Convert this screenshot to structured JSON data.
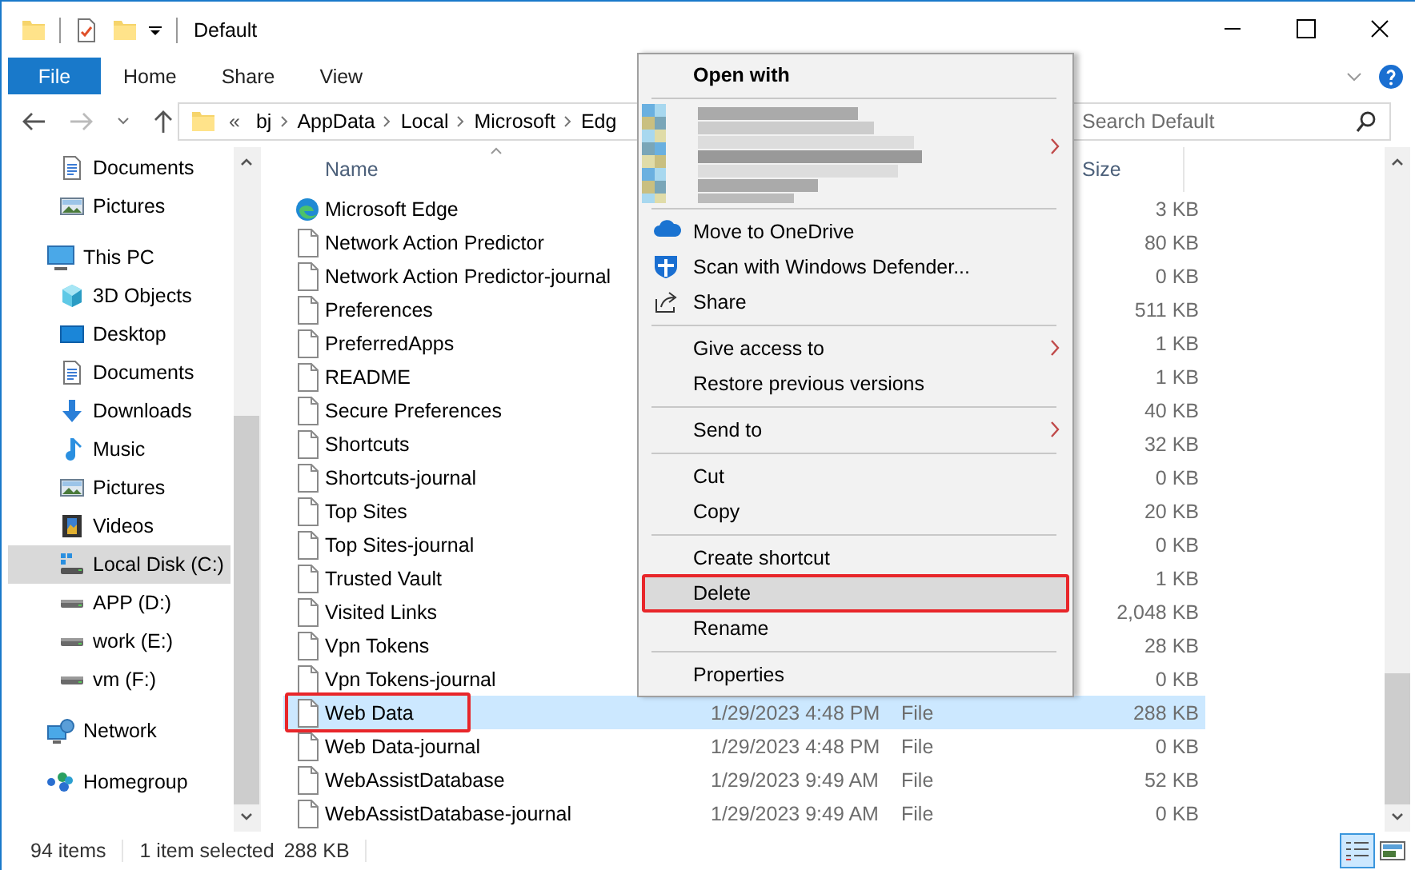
{
  "window": {
    "title": "Default"
  },
  "ribbon": {
    "file_tab": "File",
    "tabs": [
      "Home",
      "Share",
      "View"
    ]
  },
  "address_bar": {
    "overflow": "«",
    "path": [
      "bj",
      "AppData",
      "Local",
      "Microsoft",
      "Edg"
    ]
  },
  "search": {
    "placeholder": "Search Default"
  },
  "sidebar": {
    "pinned_items": [
      {
        "label": "Documents",
        "kind": "documents",
        "selected": false
      },
      {
        "label": "Pictures",
        "kind": "pictures",
        "selected": false
      }
    ],
    "items": [
      {
        "label": "This PC",
        "kind": "pc",
        "selected": false,
        "children": [
          {
            "label": "3D Objects",
            "kind": "objects",
            "selected": false
          },
          {
            "label": "Desktop",
            "kind": "desktop",
            "selected": false
          },
          {
            "label": "Documents",
            "kind": "documents",
            "selected": false
          },
          {
            "label": "Downloads",
            "kind": "downloads",
            "selected": false
          },
          {
            "label": "Music",
            "kind": "music",
            "selected": false
          },
          {
            "label": "Pictures",
            "kind": "pictures",
            "selected": false
          },
          {
            "label": "Videos",
            "kind": "videos",
            "selected": false
          },
          {
            "label": "Local Disk (C:)",
            "kind": "system_disk",
            "selected": true
          },
          {
            "label": "APP (D:)",
            "kind": "disk",
            "selected": false
          },
          {
            "label": "work (E:)",
            "kind": "disk",
            "selected": false
          },
          {
            "label": "vm (F:)",
            "kind": "disk",
            "selected": false
          }
        ]
      },
      {
        "label": "Network",
        "kind": "network",
        "selected": false
      },
      {
        "label": "Homegroup",
        "kind": "homegroup",
        "selected": false
      }
    ]
  },
  "file_list": {
    "columns": [
      "Name",
      "Size"
    ],
    "rows": [
      {
        "name": "Microsoft Edge",
        "kind": "edge",
        "size": "3 KB",
        "selected": false,
        "annotated": false
      },
      {
        "name": "Network Action Predictor",
        "kind": "file",
        "size": "80 KB",
        "selected": false,
        "annotated": false
      },
      {
        "name": "Network Action Predictor-journal",
        "kind": "file",
        "size": "0 KB",
        "selected": false,
        "annotated": false
      },
      {
        "name": "Preferences",
        "kind": "file",
        "size": "511 KB",
        "selected": false,
        "annotated": false
      },
      {
        "name": "PreferredApps",
        "kind": "file",
        "size": "1 KB",
        "selected": false,
        "annotated": false
      },
      {
        "name": "README",
        "kind": "file",
        "size": "1 KB",
        "selected": false,
        "annotated": false
      },
      {
        "name": "Secure Preferences",
        "kind": "file",
        "size": "40 KB",
        "selected": false,
        "annotated": false
      },
      {
        "name": "Shortcuts",
        "kind": "file",
        "size": "32 KB",
        "selected": false,
        "annotated": false
      },
      {
        "name": "Shortcuts-journal",
        "kind": "file",
        "size": "0 KB",
        "selected": false,
        "annotated": false
      },
      {
        "name": "Top Sites",
        "kind": "file",
        "size": "20 KB",
        "selected": false,
        "annotated": false
      },
      {
        "name": "Top Sites-journal",
        "kind": "file",
        "size": "0 KB",
        "selected": false,
        "annotated": false
      },
      {
        "name": "Trusted Vault",
        "kind": "file",
        "size": "1 KB",
        "selected": false,
        "annotated": false
      },
      {
        "name": "Visited Links",
        "kind": "file",
        "size": "2,048 KB",
        "selected": false,
        "annotated": false
      },
      {
        "name": "Vpn Tokens",
        "kind": "file",
        "size": "28 KB",
        "selected": false,
        "annotated": false
      },
      {
        "name": "Vpn Tokens-journal",
        "kind": "file",
        "size": "0 KB",
        "selected": false,
        "annotated": false
      },
      {
        "name": "Web Data",
        "kind": "file",
        "date": "1/29/2023 4:48 PM",
        "type": "File",
        "size": "288 KB",
        "selected": true,
        "annotated": true
      },
      {
        "name": "Web Data-journal",
        "kind": "file",
        "date": "1/29/2023 4:48 PM",
        "type": "File",
        "size": "0 KB",
        "selected": false,
        "annotated": false
      },
      {
        "name": "WebAssistDatabase",
        "kind": "file",
        "date": "1/29/2023 9:49 AM",
        "type": "File",
        "size": "52 KB",
        "selected": false,
        "annotated": false
      },
      {
        "name": "WebAssistDatabase-journal",
        "kind": "file",
        "date": "1/29/2023 9:49 AM",
        "type": "File",
        "size": "0 KB",
        "selected": false,
        "annotated": false
      }
    ]
  },
  "context_menu": {
    "groups": [
      [
        {
          "label": "Open with",
          "kind": "header",
          "submenu": false,
          "hovered": false,
          "annotated": false
        }
      ],
      [
        {
          "kind": "redacted",
          "submenu": true,
          "hovered": false,
          "annotated": false
        }
      ],
      [
        {
          "label": "Move to OneDrive",
          "kind": "onedrive",
          "submenu": false,
          "hovered": false,
          "annotated": false
        },
        {
          "label": "Scan with Windows Defender...",
          "kind": "shield",
          "submenu": false,
          "hovered": false,
          "annotated": false
        },
        {
          "label": "Share",
          "kind": "share",
          "submenu": false,
          "hovered": false,
          "annotated": false
        }
      ],
      [
        {
          "label": "Give access to",
          "kind": "plain",
          "submenu": true,
          "hovered": false,
          "annotated": false
        },
        {
          "label": "Restore previous versions",
          "kind": "plain",
          "submenu": false,
          "hovered": false,
          "annotated": false
        }
      ],
      [
        {
          "label": "Send to",
          "kind": "plain",
          "submenu": true,
          "hovered": false,
          "annotated": false
        }
      ],
      [
        {
          "label": "Cut",
          "kind": "plain",
          "submenu": false,
          "hovered": false,
          "annotated": false
        },
        {
          "label": "Copy",
          "kind": "plain",
          "submenu": false,
          "hovered": false,
          "annotated": false
        }
      ],
      [
        {
          "label": "Create shortcut",
          "kind": "plain",
          "submenu": false,
          "hovered": false,
          "annotated": false
        },
        {
          "label": "Delete",
          "kind": "plain",
          "submenu": false,
          "hovered": true,
          "annotated": true
        },
        {
          "label": "Rename",
          "kind": "plain",
          "submenu": false,
          "hovered": false,
          "annotated": false
        }
      ],
      [
        {
          "label": "Properties",
          "kind": "plain",
          "submenu": false,
          "hovered": false,
          "annotated": false
        }
      ]
    ]
  },
  "status_bar": {
    "item_count": "94 items",
    "selection": "1 item selected",
    "size": "288 KB"
  },
  "view_buttons": [
    {
      "kind": "details",
      "selected": true
    },
    {
      "kind": "preview",
      "selected": false
    }
  ]
}
